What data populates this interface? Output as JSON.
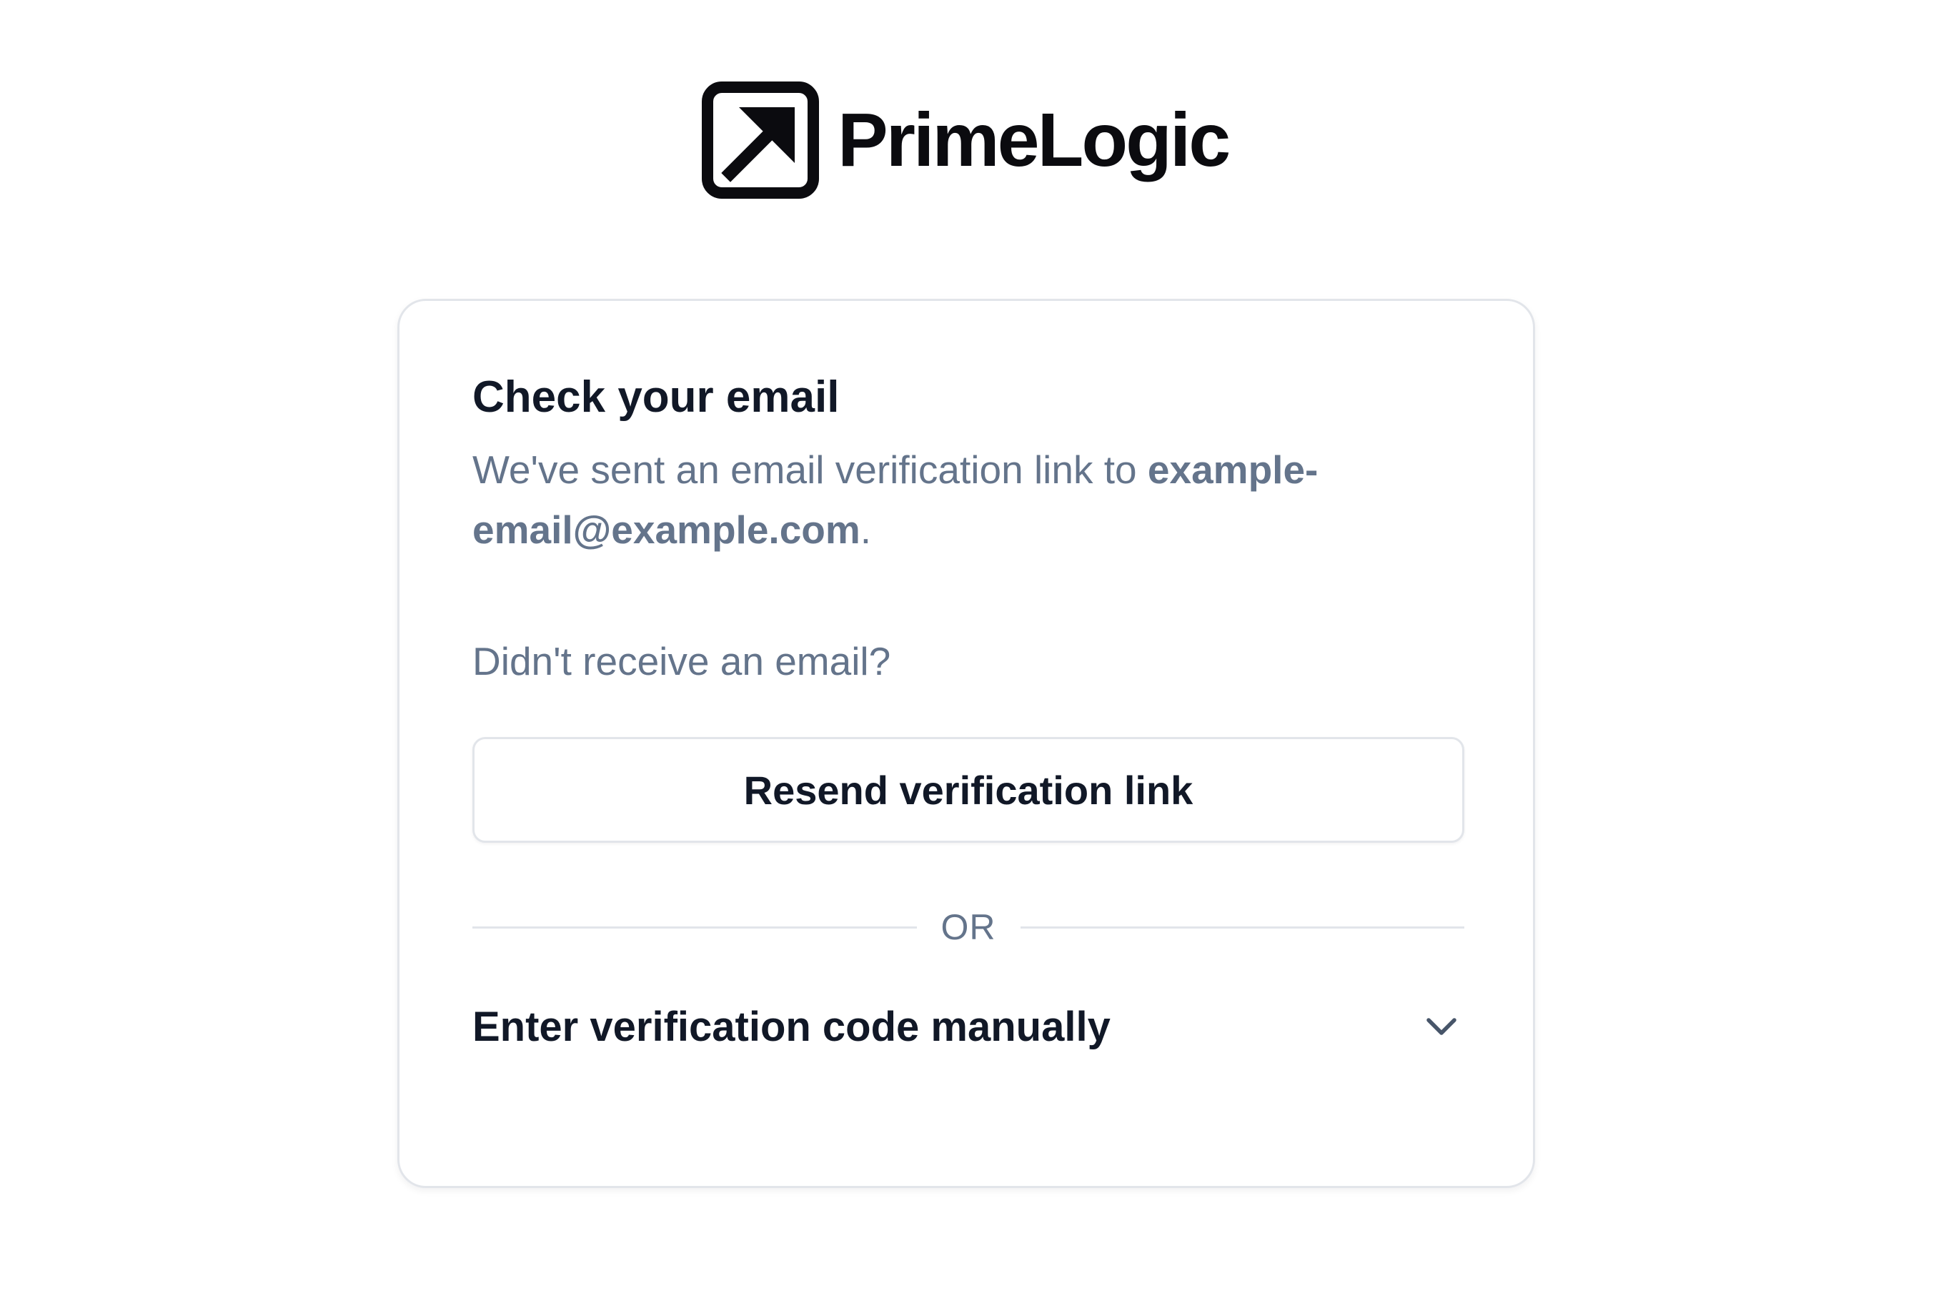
{
  "brand": {
    "name": "PrimeLogic",
    "icon": "arrow-up-right-square-icon"
  },
  "card": {
    "title": "Check your email",
    "description_prefix": "We've sent an email verification link to ",
    "email": "example-email@example.com",
    "description_suffix": ".",
    "prompt": "Didn't receive an email?",
    "resend_label": "Resend verification link",
    "divider_text": "OR",
    "manual_label": "Enter verification code manually",
    "manual_icon": "chevron-down-icon"
  },
  "colors": {
    "text_primary": "#111827",
    "text_secondary": "#64748b",
    "border": "#e2e5ea",
    "logo": "#0b0b0f"
  }
}
